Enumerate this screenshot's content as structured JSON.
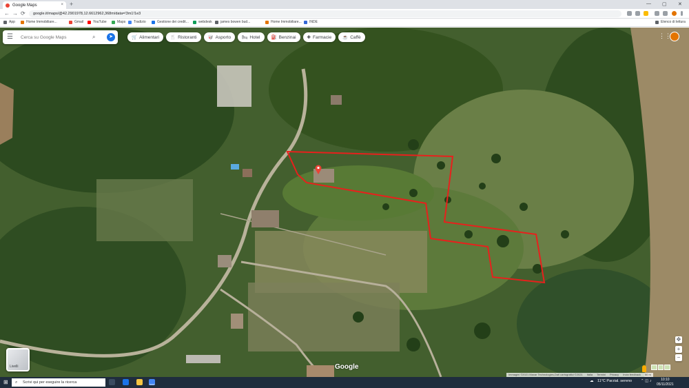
{
  "browser": {
    "tab_title": "Google Maps",
    "tab_close": "×",
    "new_tab": "+",
    "minimize": "—",
    "maximize": "▢",
    "close": "✕",
    "url": "google.it/maps/@42.2901978,12.6612962,368m/data=!3m1!1e3",
    "nav": {
      "back": "←",
      "forward": "→",
      "reload": "⟳"
    }
  },
  "bookmarks": {
    "apps_label": "App",
    "items": [
      {
        "label": "Home Immobiliare...",
        "color": "#e37400"
      },
      {
        "label": "Gmail",
        "color": "#ea4335"
      },
      {
        "label": "YouTube",
        "color": "#ff0000"
      },
      {
        "label": "Maps",
        "color": "#34a853"
      },
      {
        "label": "Tradizio",
        "color": "#4285f4"
      },
      {
        "label": "Gestione dei credit...",
        "color": "#1a73e8"
      },
      {
        "label": "webdesk",
        "color": "#0f9d58"
      },
      {
        "label": "james bowen bud...",
        "color": "#5f6368"
      },
      {
        "label": "Home Immobiliare...",
        "color": "#e37400"
      },
      {
        "label": "INDE",
        "color": "#3367d6"
      }
    ],
    "reading_list": "Elenco di lettura"
  },
  "maps": {
    "menu_icon": "☰",
    "search_placeholder": "Cerca su Google Maps",
    "search_icon": "⌕",
    "directions_icon": "➤",
    "chips": [
      {
        "icon": "🛒",
        "label": "Alimentari"
      },
      {
        "icon": "🍴",
        "label": "Ristoranti"
      },
      {
        "icon": "🥡",
        "label": "Asporto"
      },
      {
        "icon": "🛏",
        "label": "Hotel"
      },
      {
        "icon": "⛽",
        "label": "Benzinai"
      },
      {
        "icon": "✚",
        "label": "Farmacie"
      },
      {
        "icon": "☕",
        "label": "Caffè"
      }
    ],
    "apps_icon": "⋮⋮⋮",
    "layers_label": "Livelli",
    "zoom_in": "+",
    "zoom_out": "−",
    "compass": "✥",
    "logo": "Google",
    "attribution": [
      "Immagini ©2021 Maxar Technologies,Dati cartografici ©2021",
      "Italia",
      "Termini",
      "Privacy",
      "Invia feedback",
      "50 m"
    ],
    "boundary_color": "#e8201c"
  },
  "taskbar": {
    "start_icon": "⊞",
    "search_placeholder": "Scrivi qui per eseguire la ricerca",
    "weather": "11°C  Parzial. sereno",
    "time": "10:10",
    "date": "05/11/2021"
  }
}
